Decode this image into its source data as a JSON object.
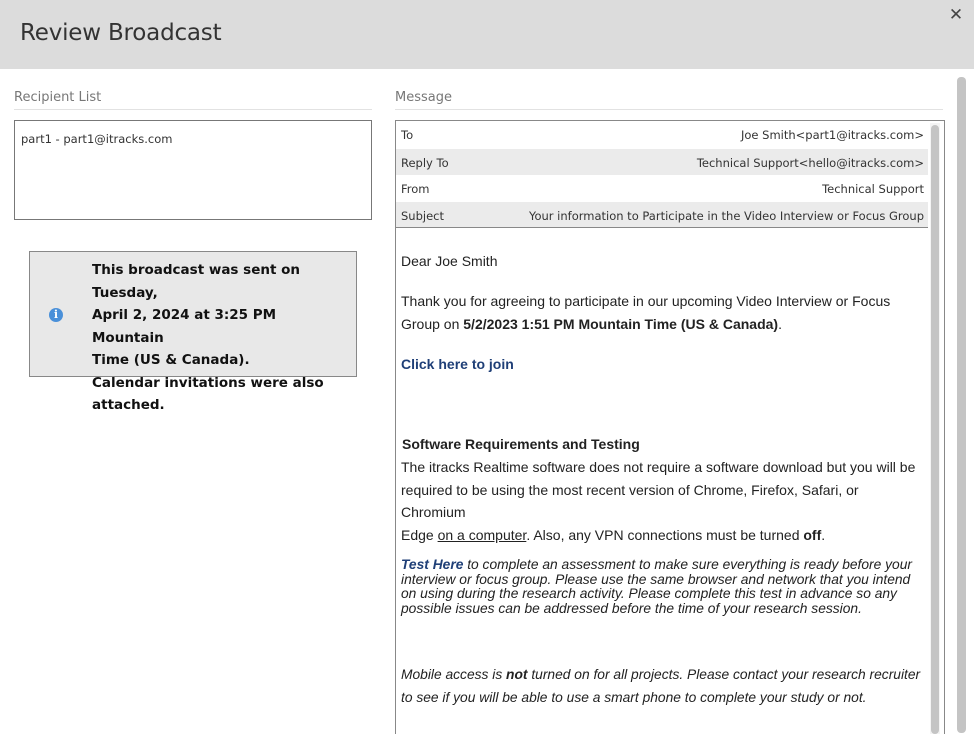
{
  "header": {
    "title": "Review Broadcast",
    "close_label": "✕"
  },
  "recipient_list": {
    "label": "Recipient List",
    "items": [
      "part1 - part1@itracks.com"
    ]
  },
  "info": {
    "icon": "info-icon",
    "line1": "This broadcast was sent on Tuesday,",
    "line2": "April 2, 2024 at 3:25 PM Mountain",
    "line3": "Time (US & Canada).",
    "line4": "Calendar invitations were also",
    "line5": "attached."
  },
  "message": {
    "label": "Message",
    "headers": {
      "to_label": "To",
      "to_value": "Joe Smith<part1@itracks.com>",
      "reply_to_label": "Reply To",
      "reply_to_value": "Technical Support<hello@itracks.com>",
      "from_label": "From",
      "from_value": "Technical Support",
      "subject_label": "Subject",
      "subject_value": "Your information to Participate in the Video Interview or Focus Group"
    },
    "body": {
      "greeting": "Dear Joe Smith",
      "thanks_1": "Thank you for agreeing to participate in our upcoming Video Interview or Focus",
      "thanks_2_pre": "Group on ",
      "thanks_2_bold": "5/2/2023 1:51 PM Mountain Time (US & Canada)",
      "thanks_2_post": ".",
      "join_link": "Click here to join",
      "sw_heading": "Software Requirements and Testing",
      "sw_1": "The itracks Realtime software does not require a software download but you will be",
      "sw_2": "required to be using the most recent version of Chrome, Firefox, Safari, or Chromium",
      "sw_3_pre": "Edge ",
      "sw_3_link": "on a computer",
      "sw_3_mid": ". Also, any VPN connections must be turned ",
      "sw_3_bold": "off",
      "sw_3_post": ".",
      "test_link": "Test Here",
      "test_1": " to complete an assessment to make sure everything is ready before your",
      "test_2": "interview or focus group.  Please use the same browser and network that you intend",
      "test_3": "on using during the research activity.  Please complete this test in advance so any",
      "test_4": "possible issues can be addressed before the time of your research session.",
      "mobile_1_pre": "Mobile access is ",
      "mobile_1_bold": "not",
      "mobile_1_post": " turned on for all projects.  Please contact your research recruiter",
      "mobile_2": "to see if you will be able to use a smart phone to complete your study or not."
    }
  }
}
